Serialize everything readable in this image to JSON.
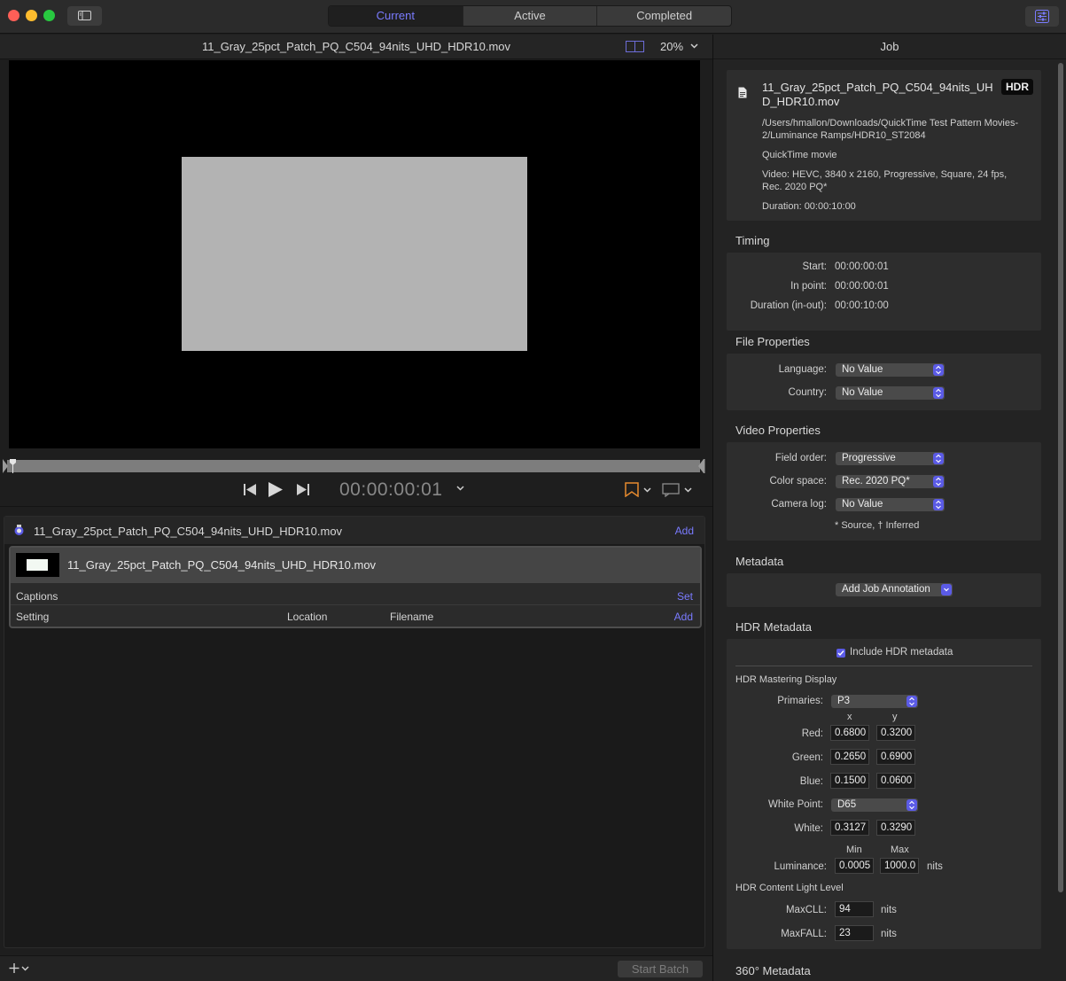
{
  "tabs": [
    "Current",
    "Active",
    "Completed"
  ],
  "viewer": {
    "title": "11_Gray_25pct_Patch_PQ_C504_94nits_UHD_HDR10.mov",
    "zoom": "20%",
    "timecode": "00:00:00:01"
  },
  "batch": {
    "source_name": "11_Gray_25pct_Patch_PQ_C504_94nits_UHD_HDR10.mov",
    "add_label": "Add",
    "job_name": "11_Gray_25pct_Patch_PQ_C504_94nits_UHD_HDR10.mov",
    "captions_label": "Captions",
    "set_label": "Set",
    "columns": [
      "Setting",
      "Location",
      "Filename"
    ],
    "add_output_label": "Add",
    "start_batch": "Start Batch"
  },
  "inspector": {
    "title": "Job",
    "file": {
      "name": "11_Gray_25pct_Patch_PQ_C504_94nits_UHD_HDR10.mov",
      "badge": "HDR",
      "path": "/Users/hmallon/Downloads/QuickTime Test Pattern Movies-2/Luminance Ramps/HDR10_ST2084",
      "kind": "QuickTime movie",
      "video": "Video: HEVC, 3840 x 2160, Progressive, Square, 24 fps, Rec. 2020 PQ*",
      "duration": "Duration: 00:00:10:00"
    },
    "timing": {
      "title": "Timing",
      "start_label": "Start:",
      "start": "00:00:00:01",
      "in_label": "In point:",
      "in": "00:00:00:01",
      "dur_label": "Duration (in-out):",
      "dur": "00:00:10:00"
    },
    "file_props": {
      "title": "File Properties",
      "language_label": "Language:",
      "language": "No Value",
      "country_label": "Country:",
      "country": "No Value"
    },
    "video_props": {
      "title": "Video Properties",
      "field_label": "Field order:",
      "field": "Progressive",
      "color_label": "Color space:",
      "color": "Rec. 2020 PQ*",
      "camera_label": "Camera log:",
      "camera": "No Value",
      "note": "* Source, † Inferred"
    },
    "metadata": {
      "title": "Metadata",
      "annotation": "Add Job Annotation"
    },
    "hdr": {
      "title": "HDR Metadata",
      "include_label": "Include HDR metadata",
      "include": true,
      "mastering_title": "HDR Mastering Display",
      "primaries_label": "Primaries:",
      "primaries": "P3",
      "x_label": "x",
      "y_label": "y",
      "red_label": "Red:",
      "red_x": "0.6800",
      "red_y": "0.3200",
      "green_label": "Green:",
      "green_x": "0.2650",
      "green_y": "0.6900",
      "blue_label": "Blue:",
      "blue_x": "0.1500",
      "blue_y": "0.0600",
      "wp_label": "White Point:",
      "wp": "D65",
      "white_label": "White:",
      "white_x": "0.3127",
      "white_y": "0.3290",
      "min_label": "Min",
      "max_label": "Max",
      "lum_label": "Luminance:",
      "lum_min": "0.0005",
      "lum_max": "1000.0",
      "nits": "nits",
      "cll_title": "HDR Content Light Level",
      "maxcll_label": "MaxCLL:",
      "maxcll": "94",
      "maxfall_label": "MaxFALL:",
      "maxfall": "23"
    },
    "next_section": "360° Metadata"
  },
  "colors": {
    "accent": "#7a7bff",
    "popup_arrow": "#5b5be6",
    "marker": "#e58a2e"
  }
}
